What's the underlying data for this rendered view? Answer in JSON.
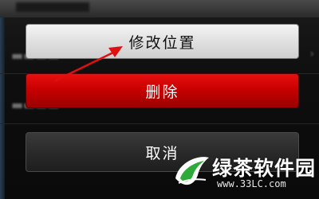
{
  "action_sheet": {
    "modify_location_label": "修改位置",
    "delete_label": "删除",
    "cancel_label": "取消"
  },
  "colors": {
    "delete_button": "#c80000",
    "annotation_arrow": "#e01010",
    "watermark_logo": "#2eaa3a"
  },
  "watermark": {
    "brand": "绿茶软件园",
    "url": "www.33LC.com"
  }
}
